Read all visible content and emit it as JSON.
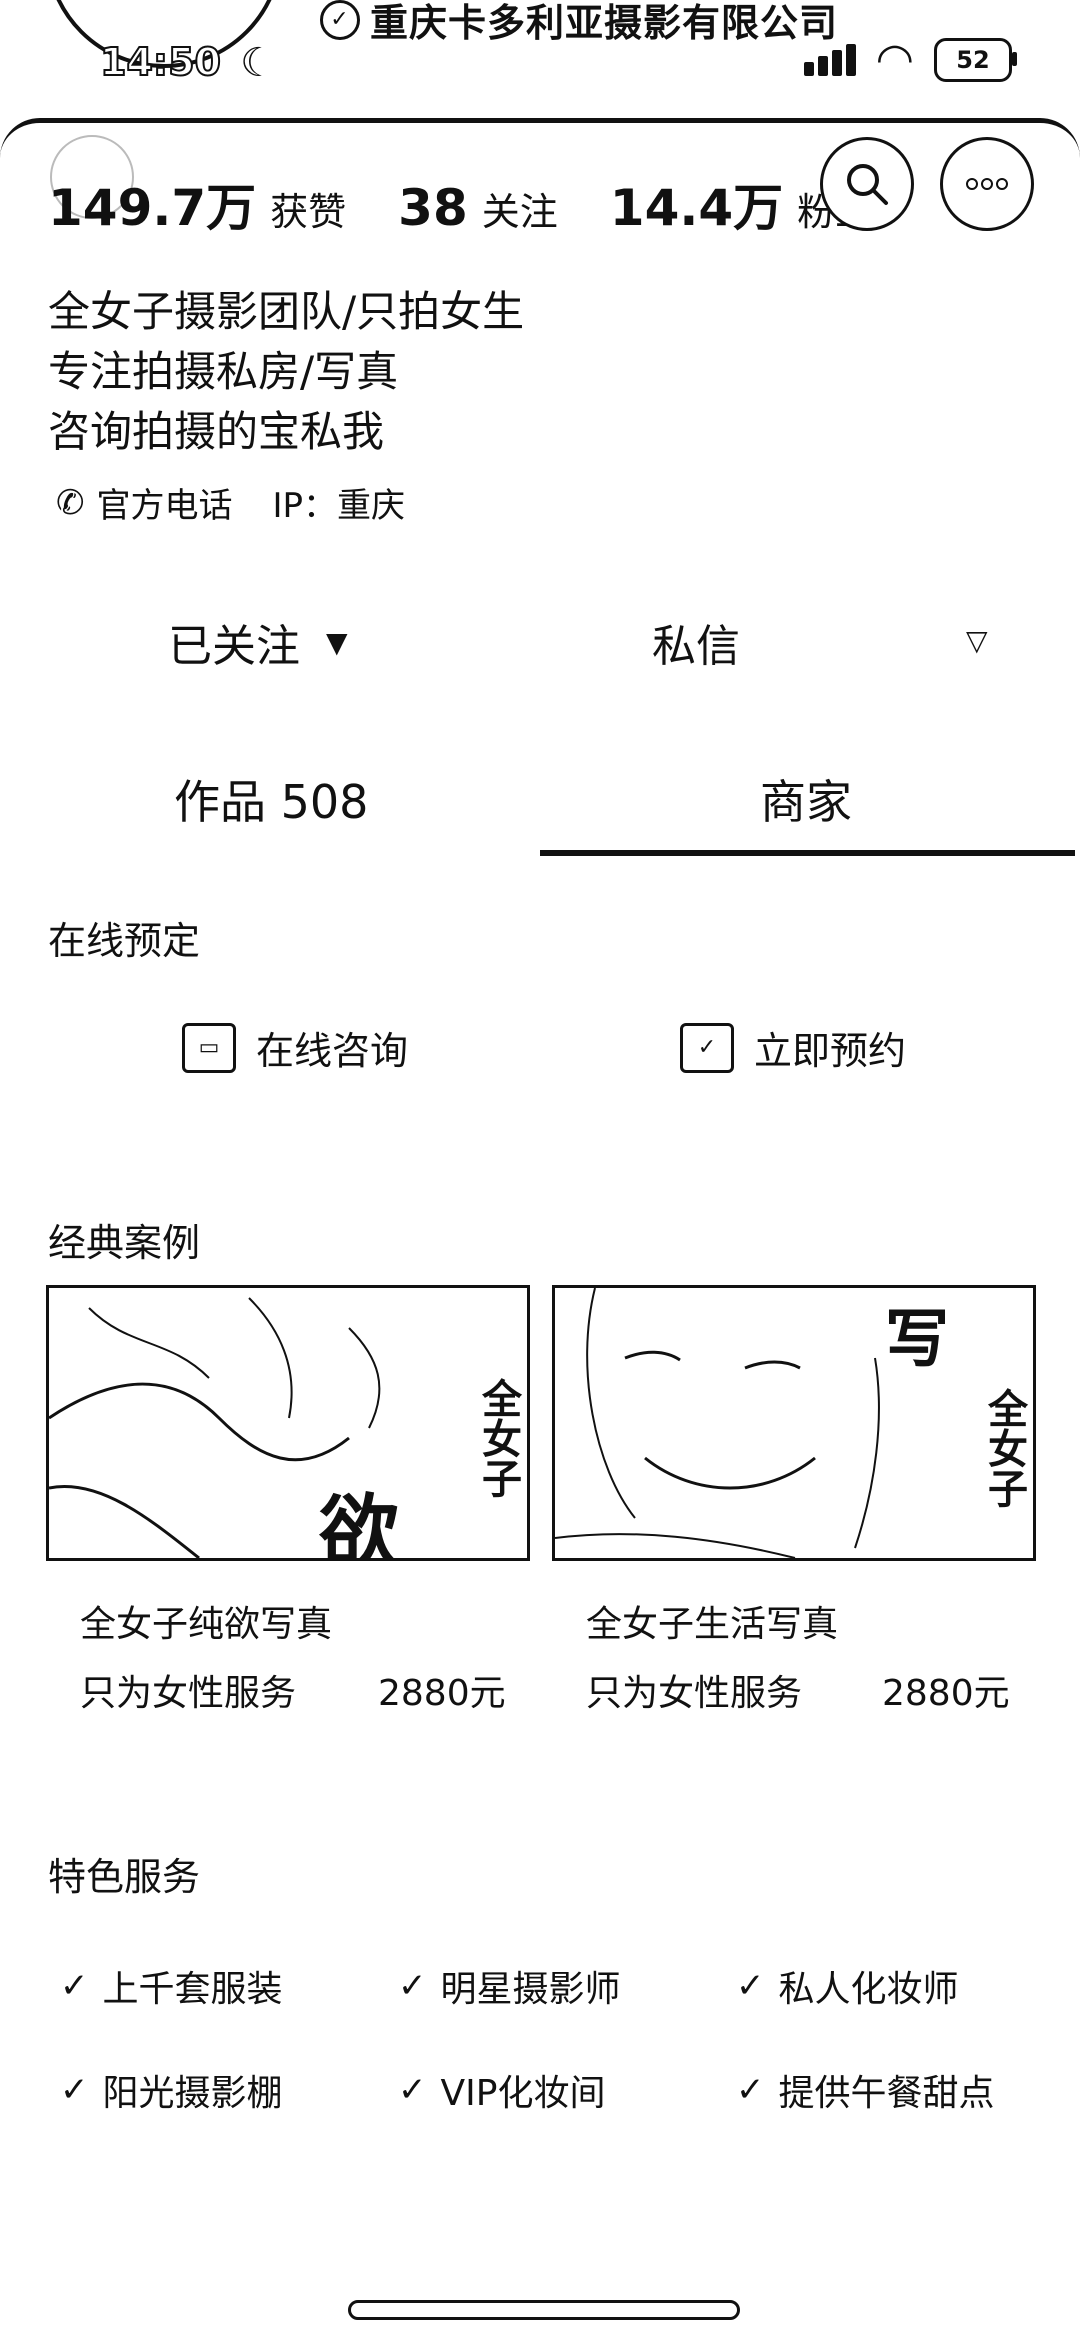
{
  "status_bar": {
    "time": "14:50",
    "battery": "52"
  },
  "profile": {
    "company_name": "重庆卡多利亚摄影有限公司",
    "stats": [
      {
        "value": "149.7万",
        "label": "获赞"
      },
      {
        "value": "38",
        "label": "关注"
      },
      {
        "value": "14.4万",
        "label": "粉丝"
      }
    ],
    "bio": [
      "全女子摄影团队/只拍女生",
      "专注拍摄私房/写真",
      "咨询拍摄的宝私我"
    ],
    "phone_label": "官方电话",
    "ip_label": "IP：重庆"
  },
  "actions": {
    "follow": "已关注",
    "message": "私信"
  },
  "tabs": [
    {
      "label": "作品 508"
    },
    {
      "label": "商家"
    }
  ],
  "online_booking": {
    "title": "在线预定",
    "consult": "在线咨询",
    "reserve": "立即预约"
  },
  "cases": {
    "title": "经典案例",
    "items": [
      {
        "title": "全女子纯欲写真",
        "subtitle": "只为女性服务",
        "price": "2880元",
        "overlay": "全女子",
        "overlay_big": "欲"
      },
      {
        "title": "全女子生活写真",
        "subtitle": "只为女性服务",
        "price": "2880元",
        "overlay": "全女子",
        "overlay_big": "写"
      }
    ]
  },
  "features": {
    "title": "特色服务",
    "items": [
      "上千套服装",
      "明星摄影师",
      "私人化妆师",
      "阳光摄影棚",
      "VIP化妆间",
      "提供午餐甜点"
    ]
  },
  "icons": {
    "verified": "verified-badge-icon",
    "phone": "phone-icon",
    "search": "search-icon",
    "more": "more-icon",
    "consult": "chat-icon",
    "reserve": "calendar-icon",
    "check": "check-icon"
  }
}
